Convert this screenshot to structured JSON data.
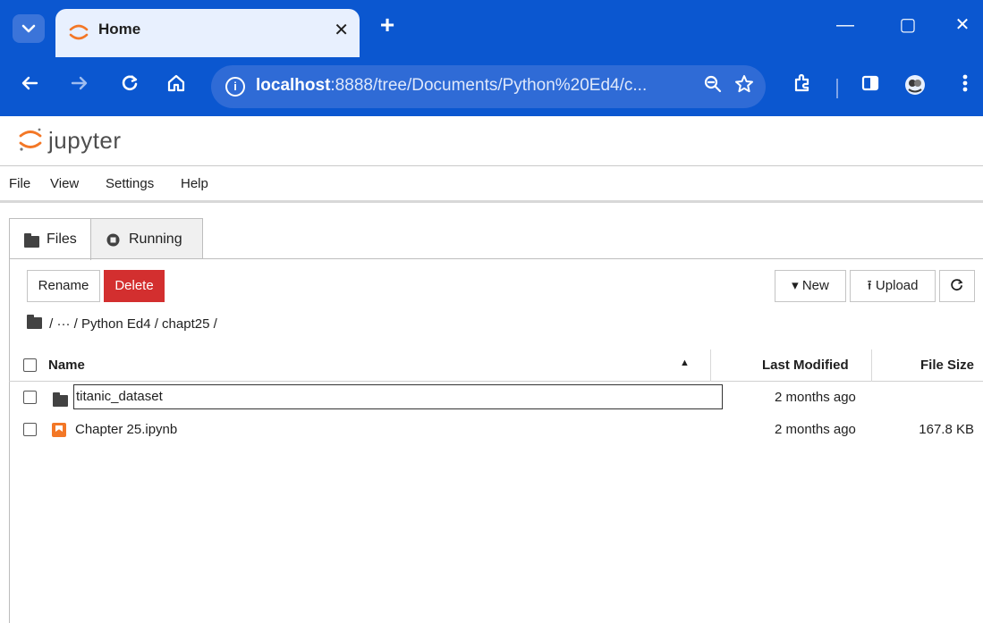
{
  "browser": {
    "tab_title": "Home",
    "tab_close": "✕",
    "new_tab": "+",
    "url_host": "localhost",
    "url_rest": ":8888/tree/Documents/Python%20Ed4/c...",
    "window_controls": {
      "minimize": "—",
      "maximize": "▢",
      "close": "✕"
    }
  },
  "jupyter": {
    "wordmark": "jupyter",
    "menu": [
      "File",
      "View",
      "Settings",
      "Help"
    ],
    "tabs": [
      {
        "label": "Files",
        "active": true
      },
      {
        "label": "Running",
        "active": false
      }
    ],
    "toolbar": {
      "rename": "Rename",
      "delete": "Delete",
      "new": "▾ New",
      "upload": "⭱ Upload",
      "refresh": "C"
    },
    "breadcrumb": "/  ···  / Python Ed4 / chapt25 /",
    "columns": {
      "name": "Name",
      "sort_indicator": "▲",
      "last_modified": "Last Modified",
      "file_size": "File Size"
    },
    "files": [
      {
        "name": "titanic_dataset",
        "type": "folder",
        "modified": "2 months ago",
        "size": ""
      },
      {
        "name": "Chapter 25.ipynb",
        "type": "notebook",
        "modified": "2 months ago",
        "size": "167.8 KB"
      }
    ]
  },
  "colors": {
    "chrome_blue": "#0b57d0",
    "tab_bg": "#e8f0fe",
    "danger": "#d32f2f",
    "jupyter_orange": "#f37726"
  },
  "icons": [
    "tab-search-icon",
    "jupyter-favicon",
    "back-icon",
    "forward-icon",
    "reload-icon",
    "home-icon",
    "site-info-icon",
    "zoom-icon",
    "star-icon",
    "extensions-icon",
    "side-panel-icon",
    "profile-icon",
    "kebab-menu-icon",
    "folder-icon",
    "notebook-icon"
  ]
}
